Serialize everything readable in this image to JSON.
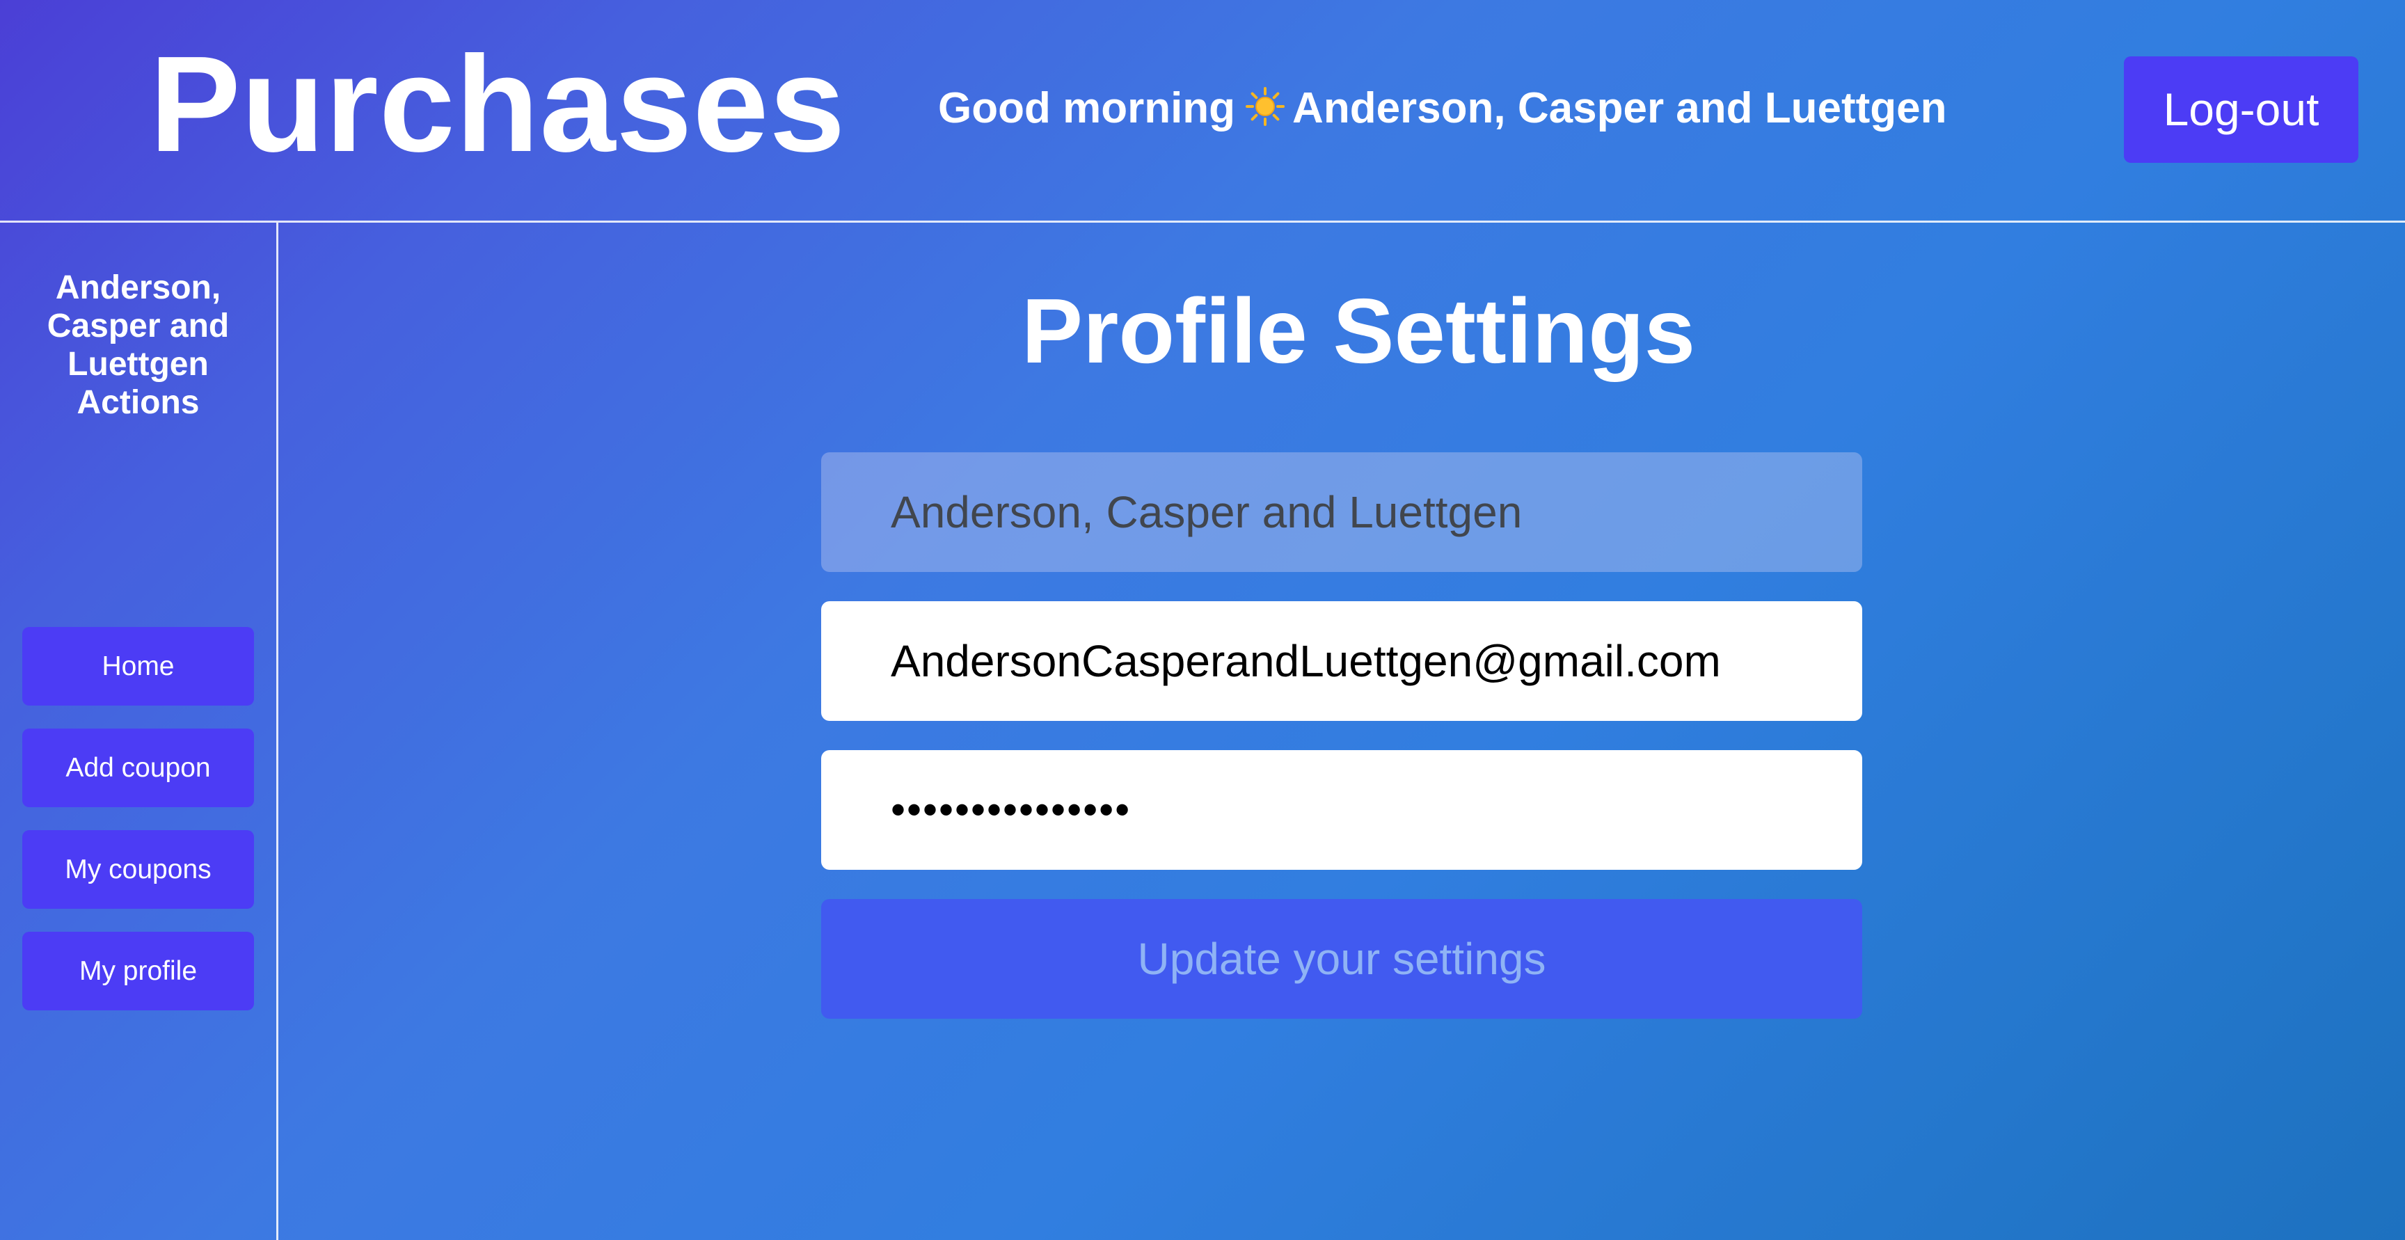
{
  "header": {
    "app_title": "Purchases",
    "greeting_prefix": "Good morning",
    "greeting_icon": "sun-icon",
    "greeting_name": "Anderson, Casper and Luettgen",
    "logout_label": "Log-out"
  },
  "sidebar": {
    "title_line1": "Anderson,",
    "title_line2": "Casper and",
    "title_line3": "Luettgen",
    "title_line4": "Actions",
    "items": [
      {
        "label": "Home"
      },
      {
        "label": "Add coupon"
      },
      {
        "label": "My coupons"
      },
      {
        "label": "My profile"
      }
    ]
  },
  "main": {
    "page_title": "Profile Settings",
    "name_field": {
      "value": "Anderson, Casper and Luettgen",
      "disabled": true
    },
    "email_field": {
      "value": "AndersonCasperandLuettgen@gmail.com"
    },
    "password_field": {
      "value": "•••••••••••••••"
    },
    "update_label": "Update your settings"
  },
  "colors": {
    "accent_button": "#4c3cf5",
    "update_button_bg": "#415af0",
    "update_button_text": "#8fb3f5",
    "background_start": "#4b3fd6",
    "background_end": "#1d71bf"
  }
}
